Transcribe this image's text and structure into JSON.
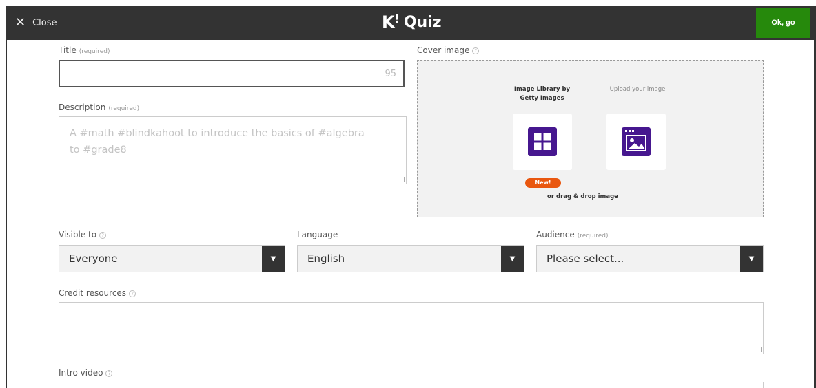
{
  "header": {
    "close_label": "Close",
    "brand_letter": "K",
    "brand_mark": "!",
    "brand_name": "Quiz",
    "ok_label": "Ok, go",
    "ok_color": "#26890c",
    "bar_color": "#333333"
  },
  "title_field": {
    "label": "Title",
    "required": "(required)",
    "value": "",
    "char_counter": "95"
  },
  "description_field": {
    "label": "Description",
    "required": "(required)",
    "placeholder": "A #math #blindkahoot to introduce the basics of #algebra to #grade8"
  },
  "cover_image": {
    "label": "Cover image",
    "library_title": "Image Library by Getty Images",
    "upload_title": "Upload your image",
    "new_badge": "New!",
    "drag_text": "or drag & drop image",
    "icon_color": "#46178f",
    "badge_color": "#e9570f"
  },
  "visible_to": {
    "label": "Visible to",
    "value": "Everyone"
  },
  "language": {
    "label": "Language",
    "value": "English"
  },
  "audience": {
    "label": "Audience",
    "required": "(required)",
    "value": "Please select..."
  },
  "credit_resources": {
    "label": "Credit resources"
  },
  "intro_video": {
    "label": "Intro video"
  }
}
